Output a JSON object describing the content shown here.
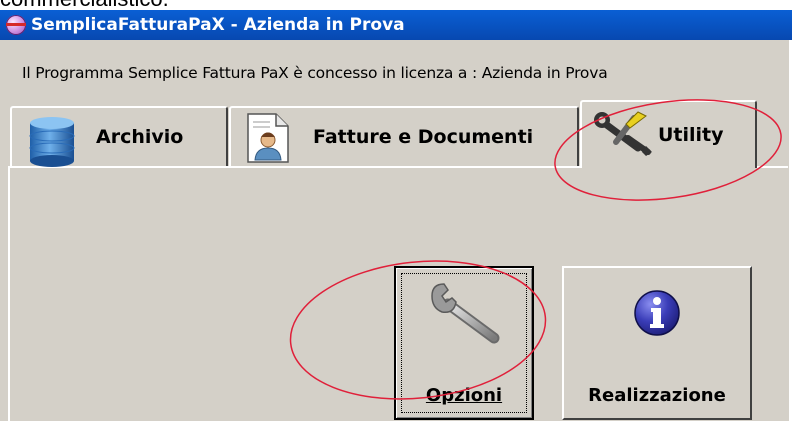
{
  "top_fragment": "commercialistico.",
  "window": {
    "title": "SemplicaFatturaPaX - Azienda in Prova",
    "license_text": "Il Programma Semplice Fattura PaX è concesso in licenza a : Azienda in Prova"
  },
  "tabs": [
    {
      "label": "Archivio",
      "icon": "database-icon"
    },
    {
      "label": "Fatture e Documenti",
      "icon": "document-person-icon"
    },
    {
      "label": "Utility",
      "icon": "tools-icon",
      "selected": true
    }
  ],
  "buttons": [
    {
      "label": "Opzioni",
      "icon": "wrench-icon",
      "focused": true
    },
    {
      "label": "Realizzazione",
      "icon": "info-icon"
    }
  ],
  "colors": {
    "titlebar": "#0a5fd4",
    "window_bg": "#d4d0c8",
    "annotation": "#e0203a"
  }
}
